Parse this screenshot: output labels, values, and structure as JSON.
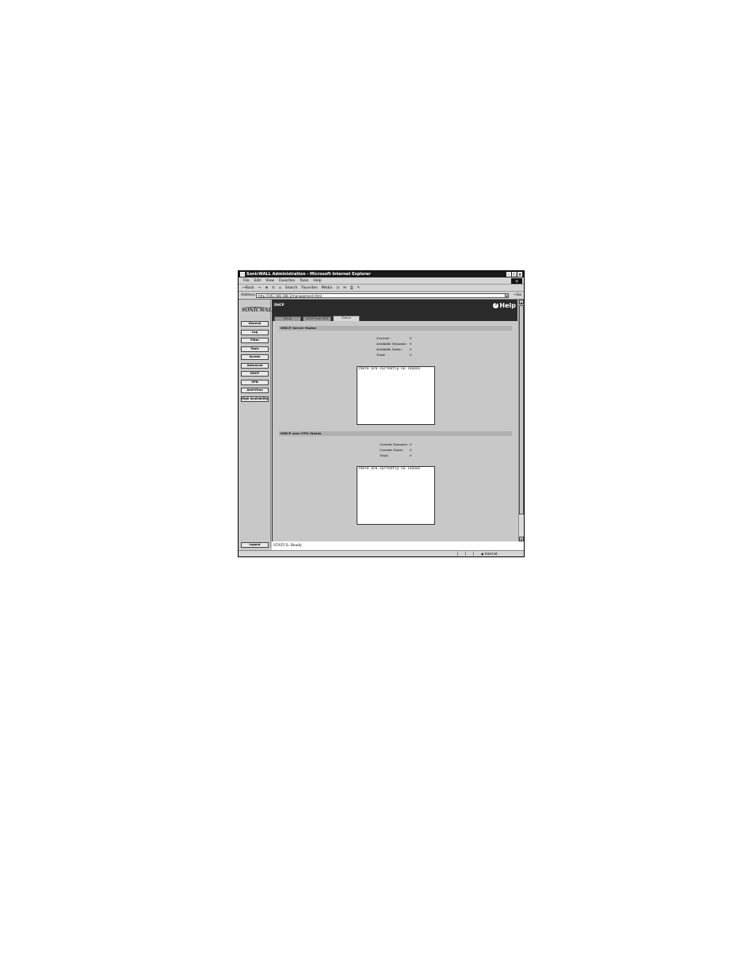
{
  "window": {
    "title": "SonicWALL Administration - Microsoft Internet Explorer",
    "controls": [
      "_",
      "□",
      "×"
    ]
  },
  "menubar": {
    "items": [
      "File",
      "Edit",
      "View",
      "Favorites",
      "Tools",
      "Help"
    ]
  },
  "toolbar": {
    "back": "⇦Back",
    "forward": "⇨",
    "search": "Search",
    "favorites": "Favorites",
    "media": "Media"
  },
  "address": {
    "label": "Address",
    "url": "http://192.168.168.1/management.html",
    "go": "Go"
  },
  "sidebar": {
    "logo": "SONICWALL",
    "items": [
      "General",
      "Log",
      "Filter",
      "Tools",
      "Access",
      "Advanced",
      "DHCP",
      "VPN",
      "Anti-Virus",
      "High Availability"
    ],
    "logout": "Logout"
  },
  "main": {
    "page_title": "DHCP",
    "help": "Help",
    "tabs": [
      "Setup",
      "DHCP over VPN",
      "Status"
    ],
    "active_tab": "Status",
    "server_status": {
      "title": "DHCP Server Status",
      "rows": [
        {
          "label": "Current :",
          "value": "0"
        },
        {
          "label": "Available Dynamic:",
          "value": "0"
        },
        {
          "label": "Available Static:",
          "value": "0"
        },
        {
          "label": "Total:",
          "value": "0"
        }
      ],
      "leases_text": "There are currently no leases"
    },
    "vpn_status": {
      "title": "DHCP over VPN Status",
      "rows": [
        {
          "label": "Current Dynamic:",
          "value": "0"
        },
        {
          "label": "Current Static:",
          "value": "0"
        },
        {
          "label": "Total:",
          "value": "0"
        }
      ],
      "leases_text": "There are currently no leases"
    }
  },
  "status": {
    "text": "STATUS: Ready"
  },
  "ie_status": {
    "zone": "Internet"
  }
}
